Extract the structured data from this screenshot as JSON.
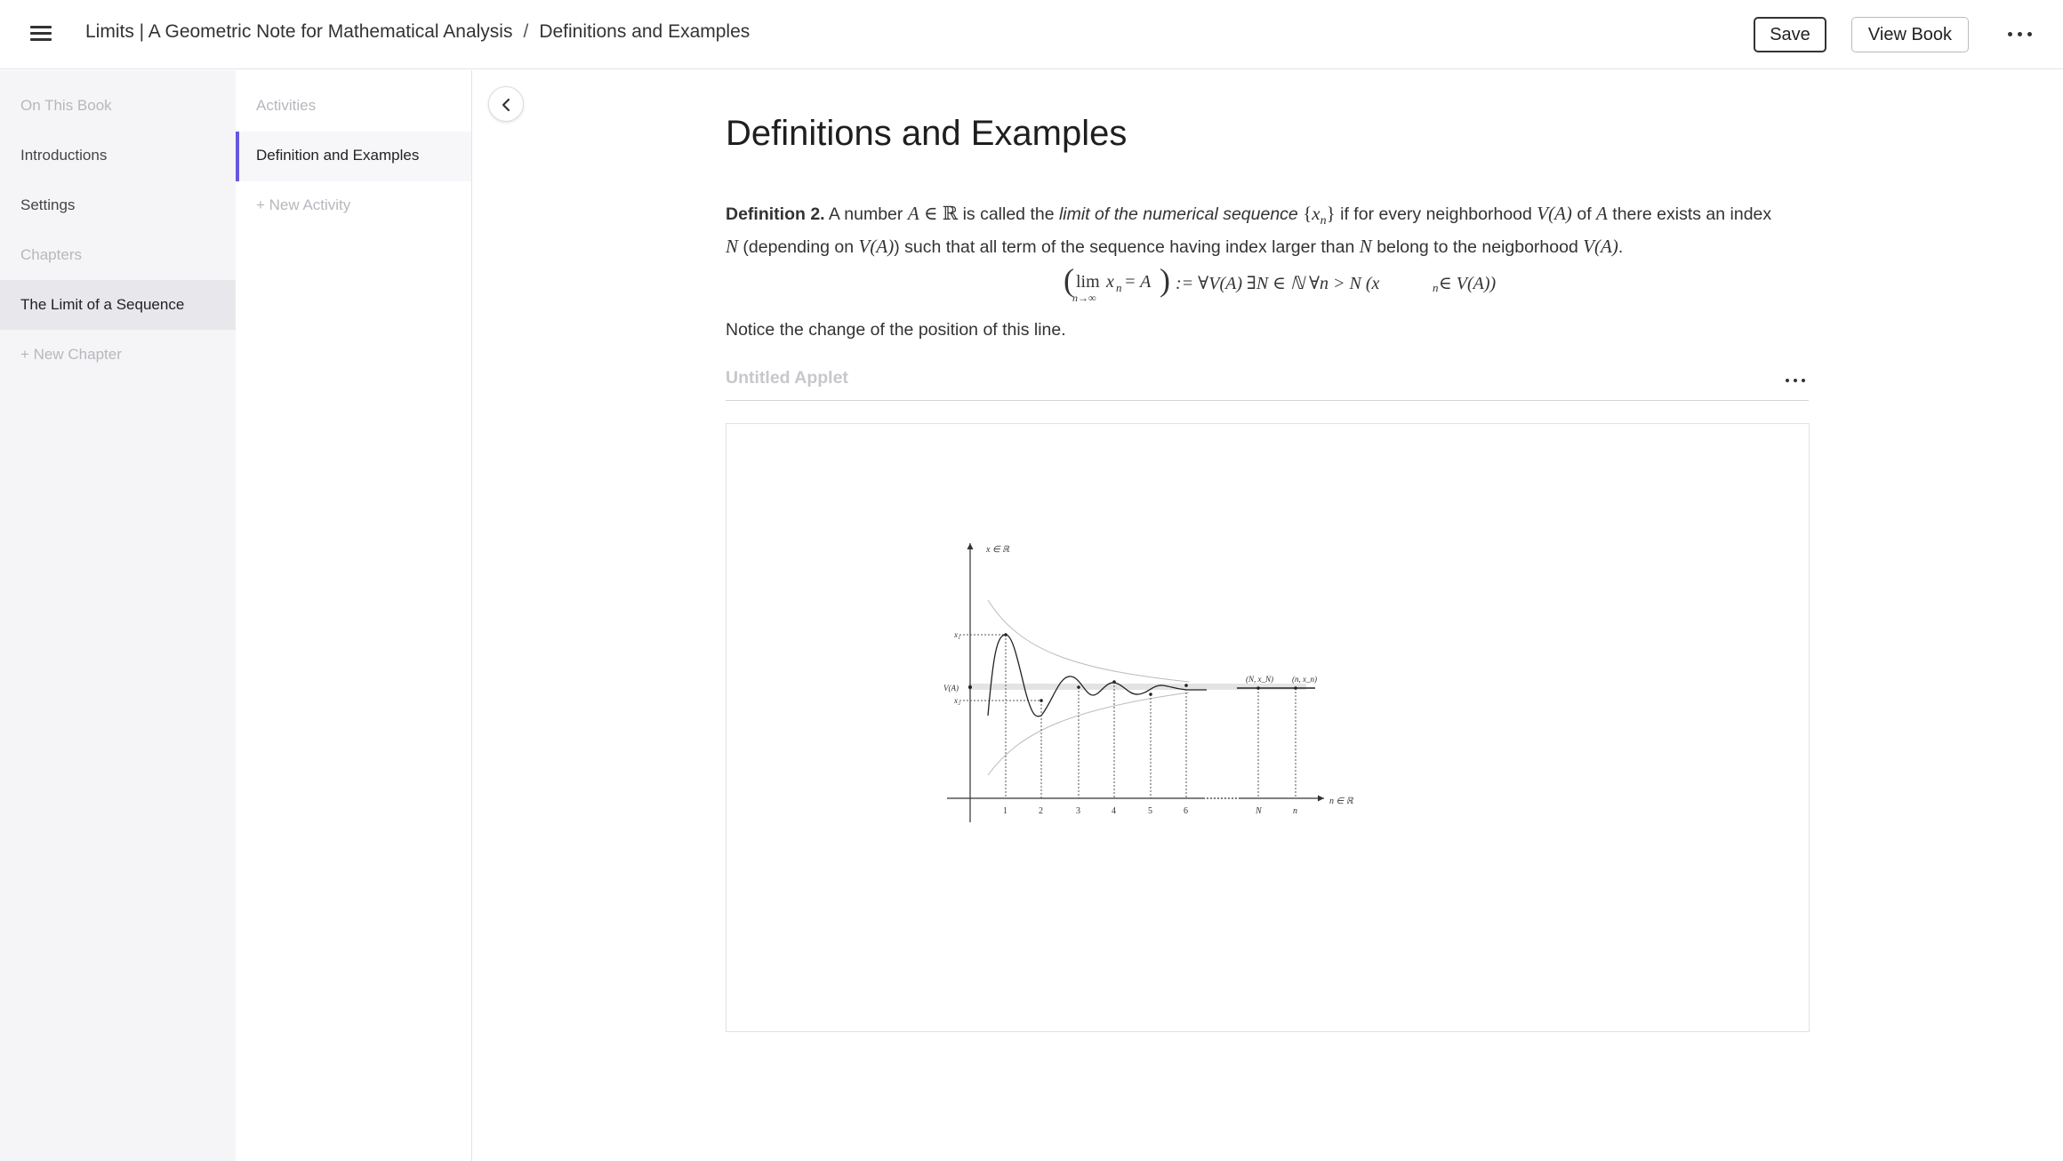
{
  "header": {
    "book_title": "Limits | A Geometric Note for Mathematical Analysis",
    "separator": "/",
    "page_title": "Definitions and Examples",
    "save_label": "Save",
    "view_book_label": "View Book"
  },
  "sidebar": {
    "on_this_book": "On This Book",
    "introductions": "Introductions",
    "settings": "Settings",
    "chapters": "Chapters",
    "chapter_selected": "The Limit of a Sequence",
    "new_chapter": "+ New Chapter"
  },
  "activities": {
    "heading": "Activities",
    "selected": "Definition and Examples",
    "new_activity": "+ New Activity"
  },
  "main": {
    "title": "Definitions and Examples",
    "def_label": "Definition 2.",
    "p1": " A number ",
    "A": "A",
    "in_R": " ∈ ℝ",
    "p2": " is called the ",
    "p2_em": "limit of the numerical sequence",
    "seq_open": "{",
    "xn": "x",
    "n_sub": "n",
    "seq_close": "}",
    "p3": " if for every neighborhood ",
    "VA": "V(A)",
    "p4": " of ",
    "p5": " there exists an index",
    "N": "N",
    "p6": " (depending on ",
    "p7": ") such that all term of the sequence having index larger than ",
    "p8": " belong to the neigborhood ",
    "p9": ".",
    "notice": "Notice the change of the position of this line."
  },
  "formula": {
    "lim": "lim",
    "lim_sub": "n→∞",
    "lhs": "x",
    "lhs_sub": "n",
    "eq": " = A",
    "rhs": ":= ∀V(A) ∃N ∈ ℕ ∀n > N  (x",
    "rhs_sub": "n",
    "rhs_end": " ∈ V(A))"
  },
  "applet": {
    "title": "Untitled Applet"
  },
  "figure": {
    "y_axis_label": "x ∈ ℝ",
    "x_axis_label": "n ∈ ℝ",
    "label_x1": "x₁",
    "label_x2": "x₂",
    "label_VA": "V(A)",
    "label_N_point": "(N, x_N)",
    "label_n_point": "(n, x_n)",
    "tick_labels": [
      "1",
      "2",
      "3",
      "4",
      "5",
      "6",
      "N",
      "n"
    ]
  }
}
